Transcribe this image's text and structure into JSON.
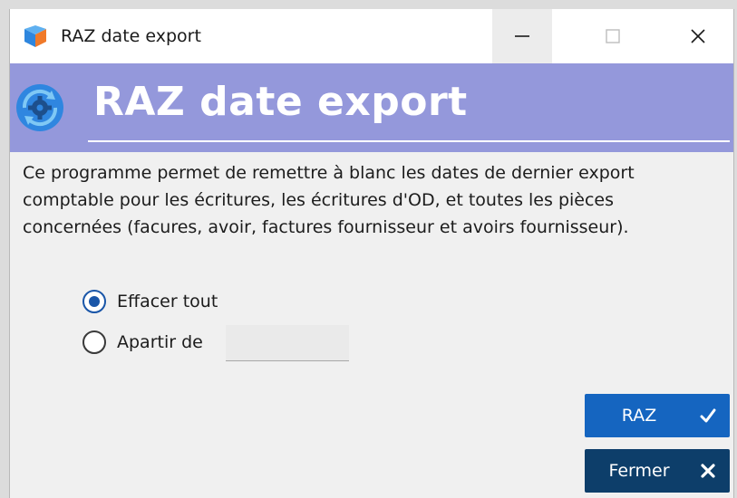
{
  "window": {
    "title": "RAZ date export"
  },
  "banner": {
    "title": "RAZ date export"
  },
  "description": [
    "Ce programme permet de remettre à blanc les dates de dernier export",
    "comptable pour les écritures, les écritures d'OD, et toutes les pièces",
    "concernées (facures, avoir, factures fournisseur et avoirs fournisseur)."
  ],
  "options": {
    "erase_all_label": "Effacer tout",
    "from_label": "Apartir de",
    "selected": "erase_all",
    "from_date_value": ""
  },
  "buttons": {
    "raz_label": "RAZ",
    "close_label": "Fermer"
  },
  "colors": {
    "banner": "#9498db",
    "raz_button": "#1565c0",
    "close_button": "#0d3e6a",
    "radio_selected": "#1a56a8"
  },
  "icons": {
    "app": "app-logo-icon",
    "banner": "gear-refresh-icon",
    "raz": "check-icon",
    "close": "close-x-icon"
  }
}
